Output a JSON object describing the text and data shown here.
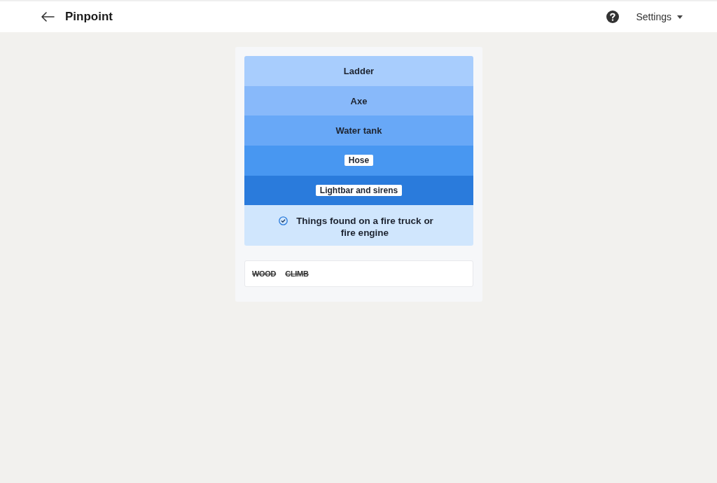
{
  "header": {
    "title": "Pinpoint",
    "settings_label": "Settings"
  },
  "clues": [
    {
      "text": "Ladder",
      "color": "#a8cdfd",
      "boxed": false
    },
    {
      "text": "Axe",
      "color": "#88b9fa",
      "boxed": false
    },
    {
      "text": "Water tank",
      "color": "#68a8f7",
      "boxed": false
    },
    {
      "text": "Hose",
      "color": "#4897f1",
      "boxed": true
    },
    {
      "text": "Lightbar and sirens",
      "color": "#2a7bdc",
      "boxed": true
    }
  ],
  "answer": {
    "text": "Things found on a fire truck or fire engine",
    "solved": true
  },
  "guesses": [
    {
      "text": "WOOD",
      "struck": true
    },
    {
      "text": "CLIMB",
      "struck": true
    }
  ]
}
